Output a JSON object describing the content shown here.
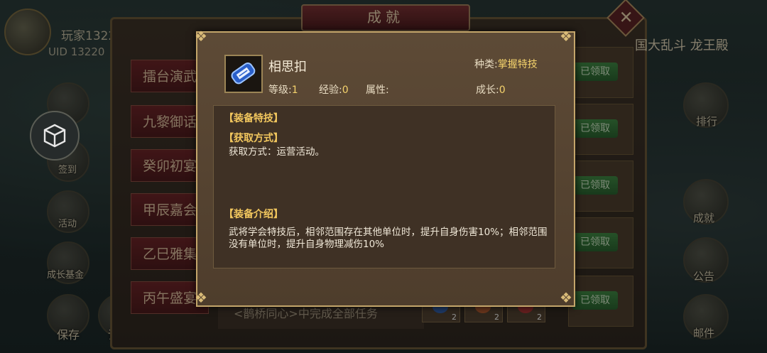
{
  "background": {
    "player": {
      "name": "玩家1322",
      "uid": "UID 13220"
    },
    "left_labels": [
      "签到",
      "活动",
      "成长基金",
      "保存",
      "读"
    ],
    "right_labels": [
      "排行",
      "成就",
      "公告",
      "邮件"
    ],
    "right_title": "国大乱斗 龙王殿",
    "achievement_window": {
      "title": "成就",
      "close_label": "✕",
      "tabs": [
        "擂台演武",
        "九黎御话",
        "癸卯初宴",
        "甲辰嘉会",
        "乙巳雅集",
        "丙午盛宴"
      ],
      "claimed_label": "已领取",
      "bottom_task": "<鹊桥同心>中完成全部任务",
      "rewards": [
        {
          "count": "2",
          "color": "#2f5fb0"
        },
        {
          "count": "2",
          "color": "#b5582a"
        },
        {
          "count": "2",
          "color": "#b23030"
        }
      ]
    }
  },
  "popup": {
    "item": {
      "name": "相思扣",
      "icon": "blue-talisman-icon",
      "kind_label": "种类:",
      "kind_value": "掌握特技",
      "level_label": "等级:",
      "level_value": "1",
      "exp_label": "经验:",
      "exp_value": "0",
      "attr_label": "属性:",
      "attr_value": "",
      "growth_label": "成长:",
      "growth_value": "0"
    },
    "sections": {
      "skill_heading": "【装备特技】",
      "acquire_heading": "【获取方式】",
      "acquire_text": "获取方式：运营活动。",
      "intro_heading": "【装备介绍】",
      "intro_text": "武将学会特技后，相邻范围存在其他单位时，提升自身伤害10%；相邻范围没有单位时，提升自身物理减伤10%"
    }
  },
  "colors": {
    "accent_gold": "#f5d36c",
    "heading": "#f2c75e",
    "claimed_green": "#3c8a40",
    "title_red": "#7a2c2e"
  }
}
